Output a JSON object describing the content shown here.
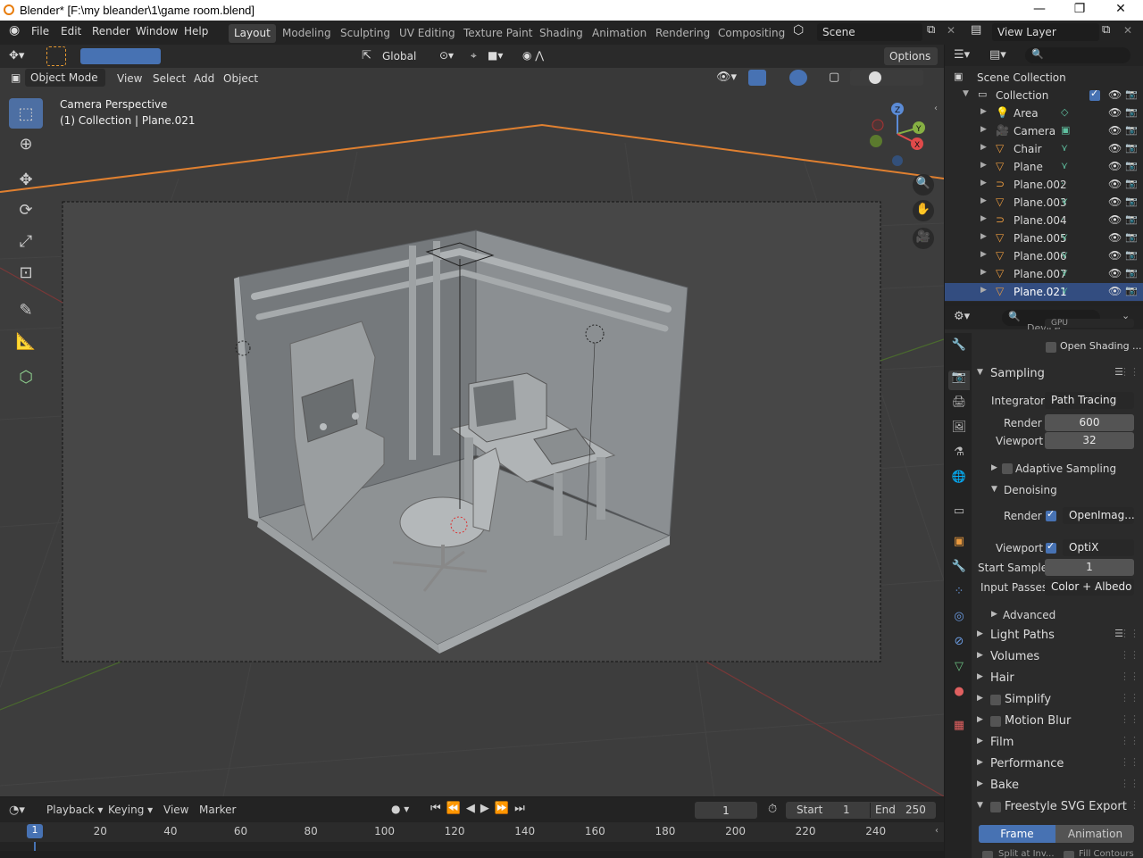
{
  "window": {
    "title": "Blender* [F:\\my bleander\\1\\game room.blend]",
    "controls": [
      "—",
      "❐",
      "✕"
    ]
  },
  "menu": [
    "File",
    "Edit",
    "Render",
    "Window",
    "Help"
  ],
  "workspaces": [
    "Layout",
    "Modeling",
    "Sculpting",
    "UV Editing",
    "Texture Paint",
    "Shading",
    "Animation",
    "Rendering",
    "Compositing"
  ],
  "active_workspace": "Layout",
  "scene": {
    "label": "Scene",
    "view_layer": "View Layer"
  },
  "viewport_header": {
    "orientation": "Global",
    "options": "Options",
    "mode": "Object Mode",
    "menus": [
      "View",
      "Select",
      "Add",
      "Object"
    ]
  },
  "viewport": {
    "camera_label": "Camera Perspective",
    "collection_label": "(1) Collection | Plane.021",
    "gizmo_axes": [
      "Z",
      "Y",
      "X"
    ]
  },
  "outliner": {
    "root": "Scene Collection",
    "collection": "Collection",
    "items": [
      {
        "name": "Area",
        "icon": "light-icon"
      },
      {
        "name": "Camera",
        "icon": "camera-icon"
      },
      {
        "name": "Chair",
        "icon": "mesh-icon"
      },
      {
        "name": "Plane",
        "icon": "mesh-icon"
      },
      {
        "name": "Plane.002",
        "icon": "curve-icon"
      },
      {
        "name": "Plane.003",
        "icon": "mesh-icon"
      },
      {
        "name": "Plane.004",
        "icon": "curve-icon"
      },
      {
        "name": "Plane.005",
        "icon": "mesh-icon"
      },
      {
        "name": "Plane.006",
        "icon": "mesh-icon"
      },
      {
        "name": "Plane.007",
        "icon": "mesh-icon"
      },
      {
        "name": "Plane.021",
        "icon": "mesh-icon",
        "selected": true
      }
    ]
  },
  "properties": {
    "device_cut": "Device",
    "device_value_cut": "GPU",
    "open_shading": "Open Shading ...",
    "sampling": {
      "title": "Sampling",
      "integrator_label": "Integrator",
      "integrator": "Path Tracing",
      "render_label": "Render",
      "render": "600",
      "viewport_label": "Viewport",
      "viewport": "32",
      "adaptive": "Adaptive Sampling",
      "denoising": "Denoising",
      "den_render_label": "Render",
      "den_render": "OpenImag...",
      "den_viewport_label": "Viewport",
      "den_viewport": "OptiX",
      "start_sample_label": "Start Sample",
      "start_sample": "1",
      "input_passes_label": "Input Passes",
      "input_passes": "Color + Albedo",
      "advanced": "Advanced"
    },
    "panels": [
      "Light Paths",
      "Volumes",
      "Hair",
      "Simplify",
      "Motion Blur",
      "Film",
      "Performance",
      "Bake",
      "Freestyle SVG Export"
    ],
    "freestyle_tabs": [
      "Frame",
      "Animation"
    ],
    "freestyle_bottom": [
      "Split at Inv...",
      "Fill Contours"
    ]
  },
  "timeline": {
    "menus": [
      "Playback",
      "Keying",
      "View",
      "Marker"
    ],
    "current_frame": "1",
    "start_label": "Start",
    "start": "1",
    "end_label": "End",
    "end": "250",
    "ruler": [
      "20",
      "40",
      "60",
      "80",
      "100",
      "120",
      "140",
      "160",
      "180",
      "200",
      "220",
      "240"
    ],
    "playhead": "1"
  },
  "colors": {
    "accent": "#4772b3",
    "selected_row": "#334d80",
    "active_tool": "#4d6fa3"
  }
}
